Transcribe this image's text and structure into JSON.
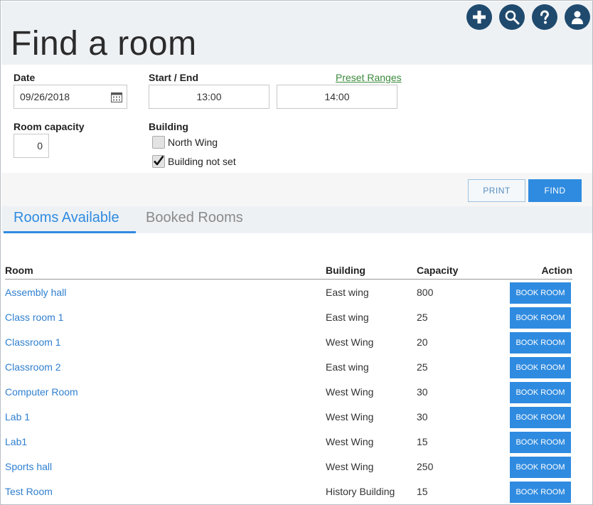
{
  "page": {
    "title": "Find a room"
  },
  "top_icons": [
    {
      "name": "add-icon"
    },
    {
      "name": "search-icon"
    },
    {
      "name": "help-icon"
    },
    {
      "name": "user-icon"
    }
  ],
  "form": {
    "date_label": "Date",
    "date_value": "09/26/2018",
    "time_label": "Start / End",
    "start_time": "13:00",
    "end_time": "14:00",
    "preset_ranges": "Preset Ranges",
    "capacity_label": "Room capacity",
    "capacity_value": "0",
    "building_label": "Building",
    "buildings": [
      {
        "label": "North Wing",
        "checked": false
      },
      {
        "label": "Building not set",
        "checked": true
      }
    ]
  },
  "actions": {
    "print": "PRINT",
    "find": "FIND"
  },
  "tabs": [
    {
      "label": "Rooms Available",
      "active": true
    },
    {
      "label": "Booked Rooms",
      "active": false
    }
  ],
  "table": {
    "headers": {
      "room": "Room",
      "building": "Building",
      "capacity": "Capacity",
      "action": "Action"
    },
    "book_label": "BOOK ROOM",
    "rows": [
      {
        "room": "Assembly hall",
        "building": "East wing",
        "capacity": "800"
      },
      {
        "room": "Class room 1",
        "building": "East wing",
        "capacity": "25"
      },
      {
        "room": "Classroom 1",
        "building": "West Wing",
        "capacity": "20"
      },
      {
        "room": "Classroom 2",
        "building": "East wing",
        "capacity": "25"
      },
      {
        "room": "Computer Room",
        "building": "West Wing",
        "capacity": "30"
      },
      {
        "room": "Lab 1",
        "building": "West Wing",
        "capacity": "30"
      },
      {
        "room": "Lab1",
        "building": "West Wing",
        "capacity": "15"
      },
      {
        "room": "Sports hall",
        "building": "West Wing",
        "capacity": "250"
      },
      {
        "room": "Test Room",
        "building": "History Building",
        "capacity": "15"
      }
    ]
  },
  "colors": {
    "accent": "#2f8be0",
    "header_bg": "#eef1f4",
    "icon_bg": "#1f4a6e",
    "preset_link": "#3b8a3b"
  }
}
